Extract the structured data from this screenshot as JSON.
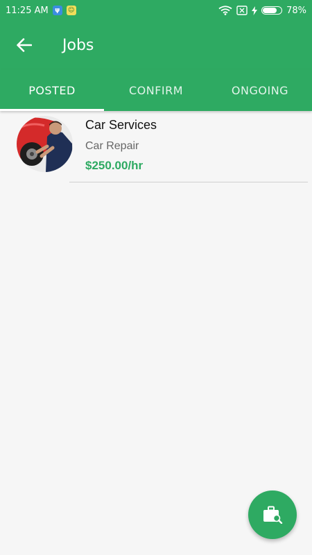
{
  "status_bar": {
    "time": "11:25 AM",
    "battery_level": 0.78,
    "battery_text": "78%"
  },
  "app_bar": {
    "title": "Jobs",
    "back_icon": "arrow-left-icon"
  },
  "tabs": [
    {
      "label": "POSTED",
      "active": true
    },
    {
      "label": "CONFIRM",
      "active": false
    },
    {
      "label": "ONGOING",
      "active": false
    }
  ],
  "jobs": [
    {
      "title": "Car Services",
      "category": "Car Repair",
      "rate": "$250.00/hr"
    }
  ],
  "fab": {
    "icon": "briefcase-search-icon"
  },
  "colors": {
    "primary": "#2eaa62",
    "background": "#f6f6f6",
    "text_primary": "#111111",
    "text_secondary": "#666666"
  }
}
